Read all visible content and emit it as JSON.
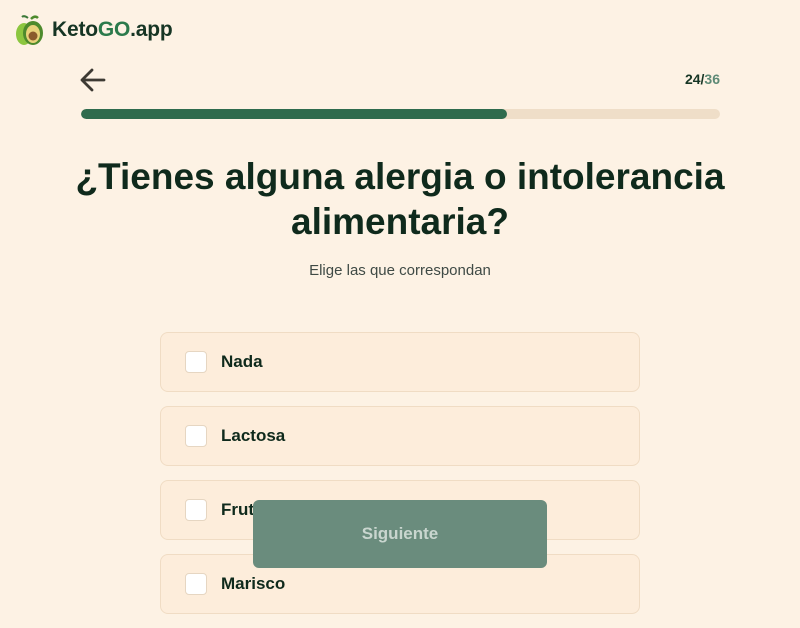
{
  "brand": {
    "name_prefix": "Keto",
    "name_go": "GO",
    "name_suffix": ".app"
  },
  "progress": {
    "current": "24",
    "separator": "/",
    "total": "36",
    "fraction": 0.667
  },
  "question": {
    "title": "¿Tienes alguna alergia o intolerancia alimentaria?",
    "subtitle": "Elige las que correspondan"
  },
  "options": [
    {
      "label": "Nada",
      "checked": false
    },
    {
      "label": "Lactosa",
      "checked": false
    },
    {
      "label": "Frutos secos",
      "checked": false
    },
    {
      "label": "Marisco",
      "checked": false
    }
  ],
  "next_button": {
    "label": "Siguiente",
    "enabled": false
  },
  "colors": {
    "background": "#fdf2e4",
    "accent_green": "#2f6b4d",
    "button_disabled": "#6a8c7d",
    "option_bg": "#fdeddb"
  },
  "icons": {
    "logo": "avocado-icon",
    "back": "arrow-left-icon",
    "checkbox": "checkbox-unchecked-icon"
  }
}
